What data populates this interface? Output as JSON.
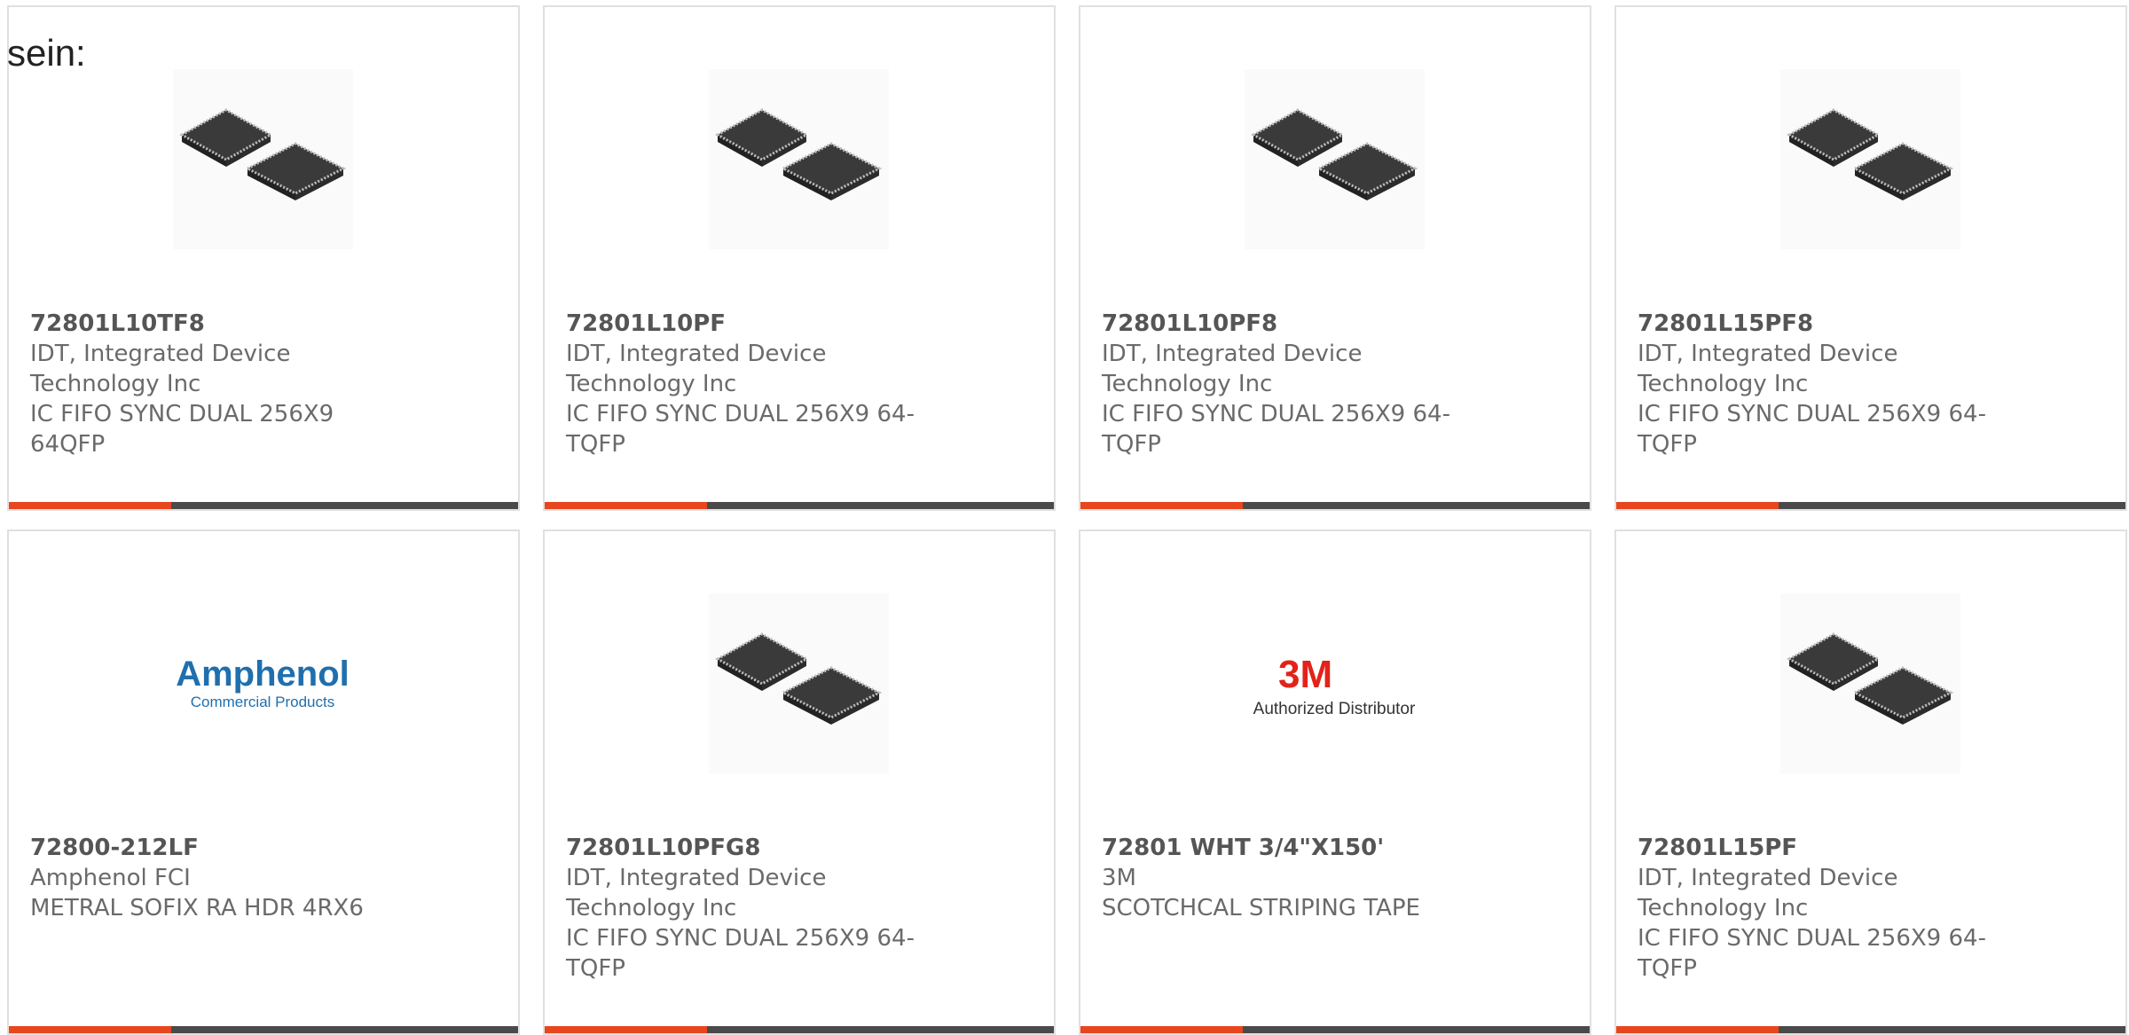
{
  "intro_text": "sein:",
  "cards": [
    {
      "part": "72801L10TF8",
      "manufacturer_line1": "IDT, Integrated Device",
      "manufacturer_line2": "Technology Inc",
      "desc_line1": "IC FIFO SYNC DUAL 256X9",
      "desc_line2": "64QFP",
      "image": "ic-chip-image"
    },
    {
      "part": "72801L10PF",
      "manufacturer_line1": "IDT, Integrated Device",
      "manufacturer_line2": "Technology Inc",
      "desc_line1": "IC FIFO SYNC DUAL 256X9 64-",
      "desc_line2": "TQFP",
      "image": "ic-chip-image"
    },
    {
      "part": "72801L10PF8",
      "manufacturer_line1": "IDT, Integrated Device",
      "manufacturer_line2": "Technology Inc",
      "desc_line1": "IC FIFO SYNC DUAL 256X9 64-",
      "desc_line2": "TQFP",
      "image": "ic-chip-image"
    },
    {
      "part": "72801L15PF8",
      "manufacturer_line1": "IDT, Integrated Device",
      "manufacturer_line2": "Technology Inc",
      "desc_line1": "IC FIFO SYNC DUAL 256X9 64-",
      "desc_line2": "TQFP",
      "image": "ic-chip-image"
    },
    {
      "part": "72800-212LF",
      "manufacturer_line1": "Amphenol FCI",
      "manufacturer_line2": "",
      "desc_line1": "METRAL SOFIX RA HDR 4RX6",
      "desc_line2": "",
      "image": "amphenol-logo",
      "logo_text1": "Amphenol",
      "logo_text2": "Commercial Products"
    },
    {
      "part": "72801L10PFG8",
      "manufacturer_line1": "IDT, Integrated Device",
      "manufacturer_line2": "Technology Inc",
      "desc_line1": "IC FIFO SYNC DUAL 256X9 64-",
      "desc_line2": "TQFP",
      "image": "ic-chip-image"
    },
    {
      "part": "72801 WHT 3/4\"X150'",
      "manufacturer_line1": "3M",
      "manufacturer_line2": "",
      "desc_line1": "SCOTCHCAL STRIPING TAPE",
      "desc_line2": "",
      "image": "3m-logo",
      "logo_text1": "3M",
      "logo_text2": "Authorized Distributor"
    },
    {
      "part": "72801L15PF",
      "manufacturer_line1": "IDT, Integrated Device",
      "manufacturer_line2": "Technology Inc",
      "desc_line1": "IC FIFO SYNC DUAL 256X9 64-",
      "desc_line2": "TQFP",
      "image": "ic-chip-image"
    }
  ],
  "colors": {
    "accent": "#e8461e",
    "bar": "#4a4a4a",
    "amphenol_blue": "#1f6fae",
    "brand_3m": "#e2231a"
  }
}
